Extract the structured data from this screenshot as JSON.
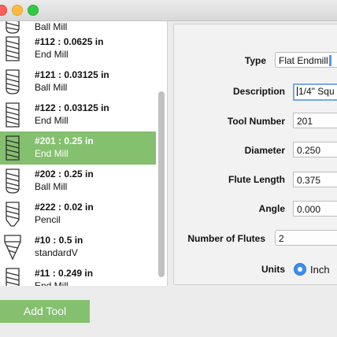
{
  "tools": [
    {
      "name": "",
      "kind": "Ball Mill",
      "icon": "ball-mill-icon",
      "selected": false
    },
    {
      "name": "#112 : 0.0625 in",
      "kind": "End Mill",
      "icon": "end-mill-icon",
      "selected": false
    },
    {
      "name": "#121 : 0.03125 in",
      "kind": "Ball Mill",
      "icon": "ball-mill-icon",
      "selected": false
    },
    {
      "name": "#122 : 0.03125 in",
      "kind": "End Mill",
      "icon": "end-mill-icon",
      "selected": false
    },
    {
      "name": "#201 : 0.25 in",
      "kind": "End Mill",
      "icon": "end-mill-icon",
      "selected": true
    },
    {
      "name": "#202 : 0.25 in",
      "kind": "Ball Mill",
      "icon": "ball-mill-icon",
      "selected": false
    },
    {
      "name": "#222 : 0.02 in",
      "kind": "Pencil",
      "icon": "pencil-tool-icon",
      "selected": false
    },
    {
      "name": "#10 : 0.5 in",
      "kind": "standardV",
      "icon": "v-bit-icon",
      "selected": false
    },
    {
      "name": "#11 : 0.249 in",
      "kind": "End Mill",
      "icon": "end-mill-icon",
      "selected": false
    }
  ],
  "details": {
    "type_label": "Type",
    "type_value": "Flat Endmill",
    "description_label": "Description",
    "description_value": "1/4\" Squ",
    "tool_number_label": "Tool Number",
    "tool_number_value": "201",
    "diameter_label": "Diameter",
    "diameter_value": "0.250",
    "flute_length_label": "Flute Length",
    "flute_length_value": "0.375",
    "angle_label": "Angle",
    "angle_value": "0.000",
    "num_flutes_label": "Number of Flutes",
    "num_flutes_value": "2",
    "units_label": "Units",
    "units_value": "Inch"
  },
  "add_tool_label": "Add Tool",
  "colors": {
    "selection": "#84c06e",
    "radio_accent": "#3b8ef0"
  }
}
